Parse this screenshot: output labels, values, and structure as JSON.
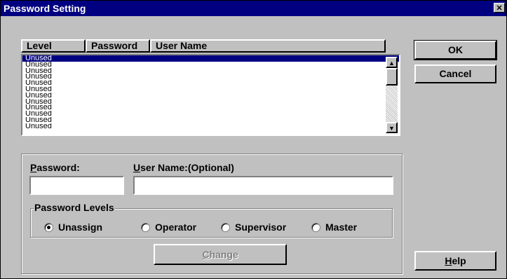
{
  "window": {
    "title": "Password Setting",
    "close_glyph": "✕"
  },
  "table": {
    "headers": [
      "Level",
      "Password",
      "User Name"
    ],
    "rows": [
      "Unused",
      "Unused",
      "Unused",
      "Unused",
      "Unused",
      "Unused",
      "Unused",
      "Unused",
      "Unused",
      "Unused",
      "Unused",
      "Unused"
    ]
  },
  "buttons": {
    "ok": "OK",
    "cancel": "Cancel",
    "help_mnemonic": "H",
    "help_rest": "elp",
    "change_mnemonic": "C",
    "change_rest": "hange"
  },
  "form": {
    "password_mnemonic": "P",
    "password_rest": "assword:",
    "username_mnemonic": "U",
    "username_rest": "ser Name:(Optional)",
    "password_value": "",
    "username_value": ""
  },
  "levels": {
    "legend": "Password Levels",
    "options": [
      {
        "label": "Unassign",
        "selected": true
      },
      {
        "label": "Operator",
        "selected": false
      },
      {
        "label": "Supervisor",
        "selected": false
      },
      {
        "label": "Master",
        "selected": false
      }
    ]
  },
  "colors": {
    "titlebar": "#000080",
    "face": "#c0c0c0",
    "selection": "#000080",
    "disabled_text": "#808080"
  }
}
